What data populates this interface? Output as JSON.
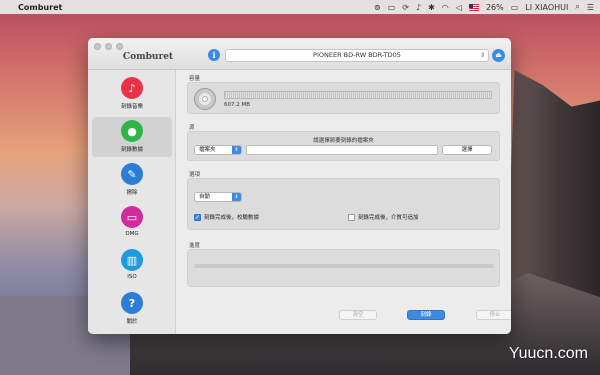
{
  "menubar": {
    "app_name": "Comburet",
    "battery": "26%",
    "user": "LI XIAOHUI"
  },
  "window": {
    "title": "Comburet",
    "device": "PIONEER BD-RW BDR-TD05"
  },
  "sidebar": {
    "items": [
      {
        "label": "刻錄音樂",
        "icon": "music-note-icon",
        "color": "#e8344a",
        "glyph": "♪"
      },
      {
        "label": "刻錄數據",
        "icon": "droplet-icon",
        "color": "#2db54a",
        "glyph": "●"
      },
      {
        "label": "擦除",
        "icon": "eraser-icon",
        "color": "#2a7fd4",
        "glyph": "✎"
      },
      {
        "label": "DMG",
        "icon": "dmg-icon",
        "color": "#d12c9e",
        "glyph": "▭"
      },
      {
        "label": "ISO",
        "icon": "trash-iso-icon",
        "color": "#1e9ae0",
        "glyph": "▥"
      },
      {
        "label": "關於",
        "icon": "question-icon",
        "color": "#2a7fd4",
        "glyph": "?"
      }
    ],
    "active_index": 1
  },
  "capacity": {
    "section_label": "容量",
    "value_text": "607.2 MB"
  },
  "source": {
    "section_label": "源",
    "hint": "請選擇將要刻錄的檔案夾",
    "type_value": "檔案夾",
    "path_value": "",
    "choose_label": "選擇"
  },
  "options": {
    "section_label": "選項",
    "speed_value": "自動",
    "verify_label": "刻錄完成後，校驗數據",
    "verify_checked": true,
    "append_label": "刻錄完成後，介質可追加",
    "append_checked": false
  },
  "progress": {
    "section_label": "進度",
    "fraction": 0
  },
  "actions": {
    "clear_label": "清空",
    "burn_label": "刻錄",
    "stop_label": "停止"
  },
  "watermark": "Yuucn.com",
  "colors": {
    "accent": "#3d8be0"
  }
}
